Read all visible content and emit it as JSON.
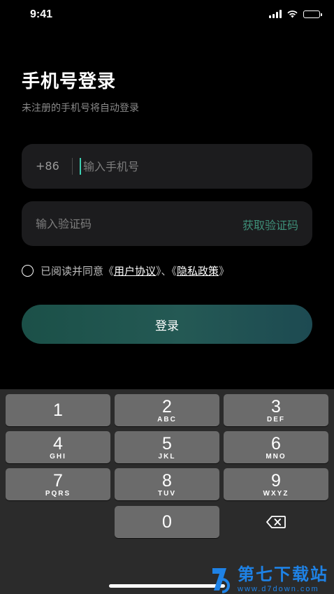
{
  "status_bar": {
    "time": "9:41"
  },
  "login": {
    "title": "手机号登录",
    "subtitle": "未注册的手机号将自动登录",
    "country_code": "+86",
    "phone_value": "",
    "phone_placeholder": "输入手机号",
    "code_value": "",
    "code_placeholder": "输入验证码",
    "get_code_label": "获取验证码",
    "agreement_prefix": "已阅读并同意《",
    "user_agreement": "用户协议",
    "agreement_sep": "》、《",
    "privacy_policy": "隐私政策",
    "agreement_suffix": "》",
    "login_button": "登录"
  },
  "keyboard": {
    "keys": [
      {
        "num": "1",
        "letters": ""
      },
      {
        "num": "2",
        "letters": "ABC"
      },
      {
        "num": "3",
        "letters": "DEF"
      },
      {
        "num": "4",
        "letters": "GHI"
      },
      {
        "num": "5",
        "letters": "JKL"
      },
      {
        "num": "6",
        "letters": "MNO"
      },
      {
        "num": "7",
        "letters": "PQRS"
      },
      {
        "num": "8",
        "letters": "TUV"
      },
      {
        "num": "9",
        "letters": "WXYZ"
      },
      {
        "num": "0",
        "letters": ""
      }
    ],
    "delete_icon": "delete-backspace-icon"
  },
  "watermark": {
    "name": "第七下载站",
    "url": "www.d7down.com"
  },
  "colors": {
    "accent": "#3ed1b4",
    "get_code": "#3e8f78",
    "watermark": "#1e82e6"
  }
}
